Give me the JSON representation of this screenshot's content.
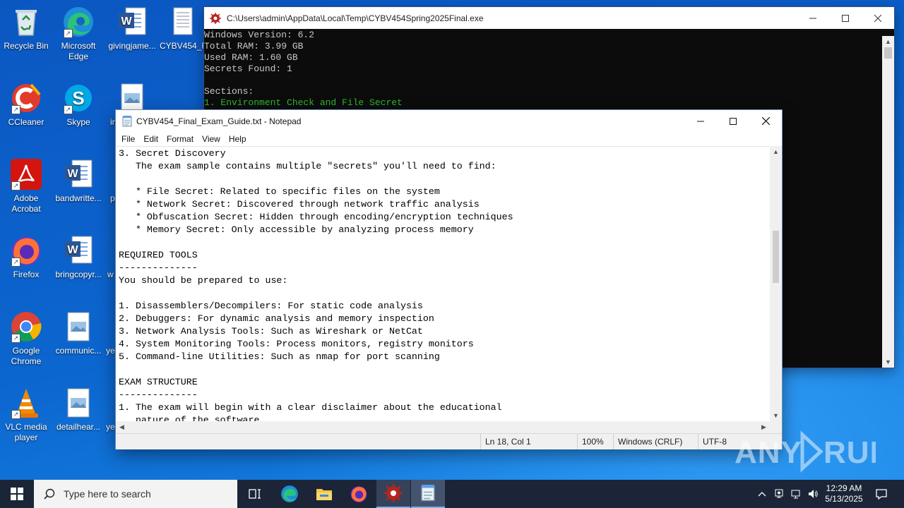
{
  "desktop": {
    "icons": [
      {
        "label": "Recycle Bin",
        "icon": "recycle-bin-icon"
      },
      {
        "label": "Microsoft Edge",
        "icon": "edge-icon"
      },
      {
        "label": "givingjame...",
        "icon": "word-document-icon"
      },
      {
        "label": "CYBV454_F",
        "icon": "text-document-icon"
      },
      {
        "label": "CCleaner",
        "icon": "ccleaner-icon"
      },
      {
        "label": "Skype",
        "icon": "skype-icon"
      },
      {
        "label": "in",
        "icon": "image-file-icon"
      },
      {
        "label": "Adobe Acrobat",
        "icon": "acrobat-icon"
      },
      {
        "label": "bandwritte...",
        "icon": "word-document-icon"
      },
      {
        "label": "p",
        "icon": "file-icon"
      },
      {
        "label": "Firefox",
        "icon": "firefox-icon"
      },
      {
        "label": "bringcopyr...",
        "icon": "word-document-icon"
      },
      {
        "label": "w",
        "icon": "file-icon"
      },
      {
        "label": "Google Chrome",
        "icon": "chrome-icon"
      },
      {
        "label": "communic...",
        "icon": "image-file-icon"
      },
      {
        "label": "ye",
        "icon": "file-icon"
      },
      {
        "label": "VLC media player",
        "icon": "vlc-icon"
      },
      {
        "label": "detailhear...",
        "icon": "image-file-icon"
      },
      {
        "label": "ye",
        "icon": "file-icon"
      }
    ]
  },
  "console": {
    "title": "C:\\Users\\admin\\AppData\\Local\\Temp\\CYBV454Spring2025Final.exe",
    "lines": [
      "Windows Version: 6.2",
      "Total RAM: 3.99 GB",
      "Used RAM: 1.60 GB",
      "Secrets Found: 1",
      "",
      "Sections:"
    ],
    "highlight_line": "1. Environment Check and File Secret",
    "highlight_color": "#2eb82e"
  },
  "notepad": {
    "title": "CYBV454_Final_Exam_Guide.txt - Notepad",
    "menu": [
      "File",
      "Edit",
      "Format",
      "View",
      "Help"
    ],
    "text": "3. Secret Discovery\n   The exam sample contains multiple \"secrets\" you'll need to find:\n\n   * File Secret: Related to specific files on the system\n   * Network Secret: Discovered through network traffic analysis\n   * Obfuscation Secret: Hidden through encoding/encryption techniques\n   * Memory Secret: Only accessible by analyzing process memory\n\nREQUIRED TOOLS\n--------------\nYou should be prepared to use:\n\n1. Disassemblers/Decompilers: For static code analysis\n2. Debuggers: For dynamic analysis and memory inspection\n3. Network Analysis Tools: Such as Wireshark or NetCat\n4. System Monitoring Tools: Process monitors, registry monitors\n5. Command-line Utilities: Such as nmap for port scanning\n\nEXAM STRUCTURE\n--------------\n1. The exam will begin with a clear disclaimer about the educational\n   nature of the software",
    "status": {
      "position": "Ln 18, Col 1",
      "zoom": "100%",
      "line_ending": "Windows (CRLF)",
      "encoding": "UTF-8"
    }
  },
  "taskbar": {
    "search_placeholder": "Type here to search",
    "apps": [
      "start-icon",
      "task-view-icon",
      "edge-icon",
      "file-explorer-icon",
      "firefox-icon",
      "exam-app-icon",
      "notepad-icon"
    ],
    "clock_time": "12:29 AM",
    "clock_date": "5/13/2025"
  },
  "watermark": "ANY RUN",
  "colors": {
    "taskbar": "#1b2537",
    "console_bg": "#0c0c0c",
    "desktop": "#0b5fc8"
  }
}
